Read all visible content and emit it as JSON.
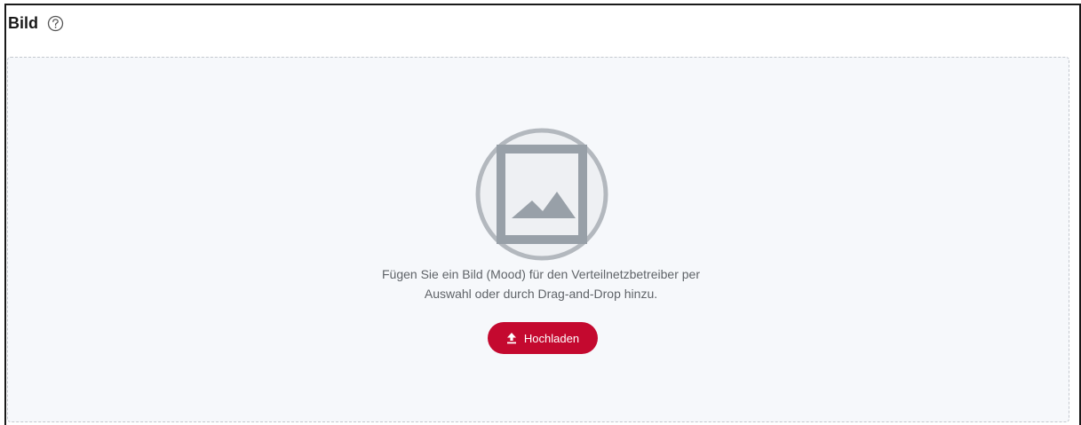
{
  "section": {
    "title": "Bild",
    "help_icon": "help-circle-icon"
  },
  "dropzone": {
    "placeholder_icon": "image-placeholder-icon",
    "hint_line1": "Fügen Sie ein Bild (Mood) für den Verteilnetzbetreiber per",
    "hint_line2": "Auswahl oder durch Drag-and-Drop hinzu.",
    "upload_label": "Hochladen",
    "upload_icon": "upload-icon"
  },
  "colors": {
    "accent": "#c4092f",
    "dropzone_bg": "#f6f8fb",
    "placeholder_gray": "#9aa0a6"
  }
}
